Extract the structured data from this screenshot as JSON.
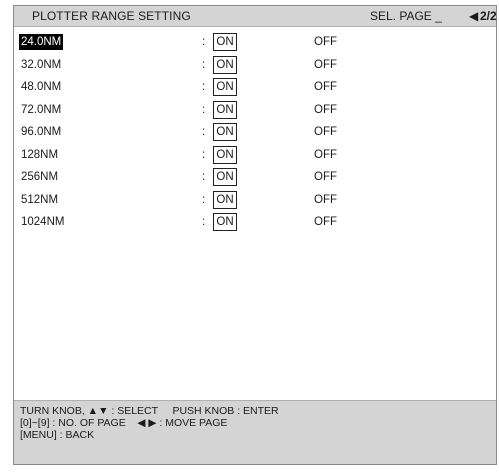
{
  "header": {
    "title": "PLOTTER RANGE SETTING",
    "sel_page_label": "SEL. PAGE _",
    "page_arrow": "◀",
    "page_number": "2/2"
  },
  "ranges": [
    {
      "label": "24.0NM",
      "on": "ON",
      "off": "OFF",
      "selected": true
    },
    {
      "label": "32.0NM",
      "on": "ON",
      "off": "OFF"
    },
    {
      "label": "48.0NM",
      "on": "ON",
      "off": "OFF"
    },
    {
      "label": "72.0NM",
      "on": "ON",
      "off": "OFF"
    },
    {
      "label": "96.0NM",
      "on": "ON",
      "off": "OFF"
    },
    {
      "label": "128NM",
      "on": "ON",
      "off": "OFF"
    },
    {
      "label": "256NM",
      "on": "ON",
      "off": "OFF"
    },
    {
      "label": "512NM",
      "on": "ON",
      "off": "OFF"
    },
    {
      "label": "1024NM",
      "on": "ON",
      "off": "OFF"
    }
  ],
  "separator": ":",
  "help": {
    "line1": "TURN KNOB, ▲▼ : SELECT     PUSH KNOB : ENTER",
    "line2": "[0]~[9] : NO. OF PAGE    ◀ ▶ : MOVE PAGE",
    "line3": "[MENU] : BACK"
  },
  "colors": {
    "selection_bg": "#000000",
    "selection_fg": "#ffffff",
    "bar_bg": "#d4d4d4"
  }
}
